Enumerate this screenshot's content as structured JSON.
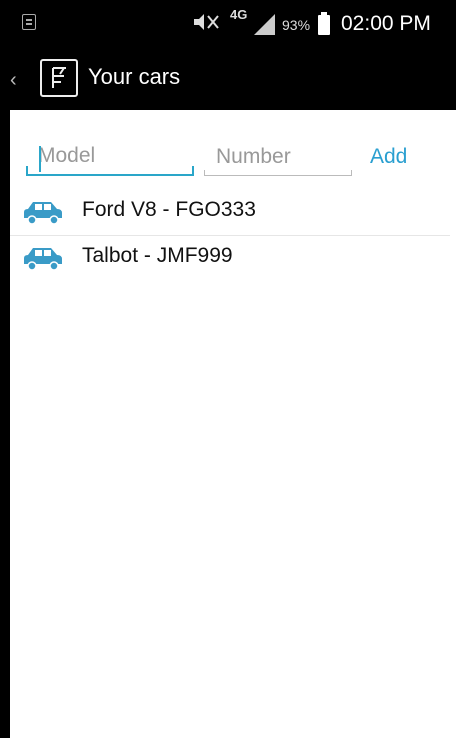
{
  "status_bar": {
    "network": "4G",
    "battery": "93%",
    "time": "02:00 PM"
  },
  "action_bar": {
    "title": "Your cars",
    "back_icon": "chevron-left-icon",
    "app_icon": "app-logo-icon"
  },
  "form": {
    "model_placeholder": "Model",
    "number_placeholder": "Number",
    "add_label": "Add"
  },
  "cars": [
    {
      "label": "Ford V8 - FGO333",
      "icon": "car-icon"
    },
    {
      "label": "Talbot - JMF999",
      "icon": "car-icon"
    }
  ],
  "colors": {
    "accent": "#2aa6c9",
    "car_icon": "#3a9bc7",
    "background": "#ffffff",
    "bar": "#000000"
  }
}
